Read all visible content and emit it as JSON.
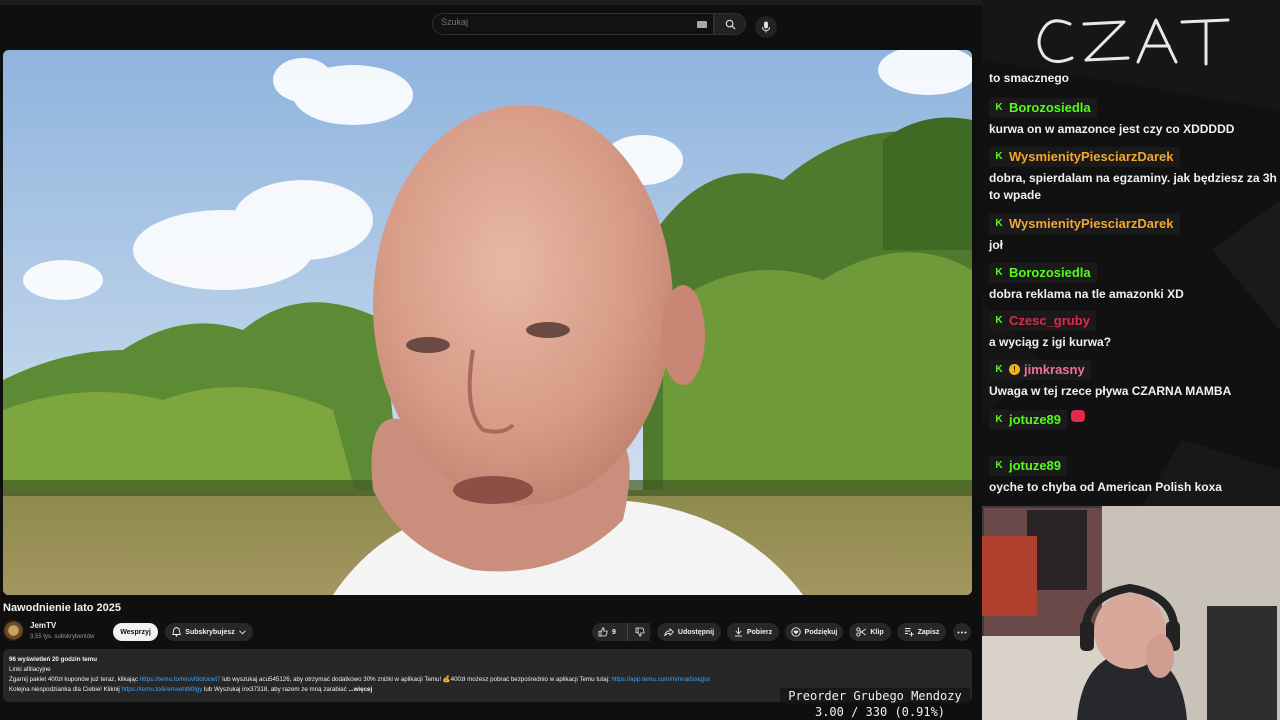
{
  "search": {
    "placeholder": "Szukaj"
  },
  "video": {
    "title": "Nawodnienie lato 2025",
    "channel": "JemTV",
    "subscribers": "3,55 tys. subskrybentów",
    "support_label": "Wesprzyj",
    "subscribe_label": "Subskrybujesz",
    "like_count": "9",
    "share_label": "Udostępnij",
    "download_label": "Pobierz",
    "thanks_label": "Podziękuj",
    "clip_label": "Klip",
    "save_label": "Zapisz"
  },
  "description": {
    "stats": "96 wyświetleń  20 godzin temu",
    "line1": "Linki afiliacyjne",
    "line2_a": "Zgarnij pakiet 400zł kuponów już teraz, klikając ",
    "line2_link1": "https://temu.to/m/uvfdotocwt7",
    "line2_b": " lub wyszukaj acu545126, aby otrzymać dodatkowo 30% zniżki w aplikacji Temu! 💰400zł możesz pobrać bezpośrednio w aplikacji Temu tutaj: ",
    "line2_link2": "https://app.temu.com/m/nnadsxiqjsx",
    "line3_a": "Kolejna niespodzianka dla Ciebie! Kliknij ",
    "line3_link": "https://temu.to/k/emveht80lgy",
    "line3_b": " lub Wyszukaj inx37318, aby razem ze mną zarabiać",
    "more": "...więcej"
  },
  "chat": {
    "first_message": "to smacznego",
    "messages": [
      {
        "user": "Borozosiedla",
        "color": "#53fc18",
        "text": "kurwa on w amazonce jest czy co XDDDDD"
      },
      {
        "user": "WysmienityPiesciarzDarek",
        "color": "#f2a72e",
        "text": "dobra, spierdalam na egzaminy. jak będziesz za 3h to wpade"
      },
      {
        "user": "WysmienityPiesciarzDarek",
        "color": "#f2a72e",
        "text": "joł"
      },
      {
        "user": "Borozosiedla",
        "color": "#53fc18",
        "text": "dobra reklama na tle amazonki XD"
      },
      {
        "user": "Czesc_gruby",
        "color": "#e0294d",
        "text": "a wyciąg z igi kurwa?"
      },
      {
        "user": "jimkrasny",
        "color": "#f06fa0",
        "text": "Uwaga w tej rzece pływa CZARNA MAMBA"
      },
      {
        "user": "jotuze89",
        "color": "#53fc18",
        "text": ""
      },
      {
        "user": "jotuze89",
        "color": "#53fc18",
        "text": "oyche to chyba od American Polish koxa"
      }
    ]
  },
  "overlay": {
    "goal_title": "Preorder Grubego Mendozy",
    "goal_progress": "3.00 / 330 (0.91%)",
    "czat_logo": "CZAT"
  },
  "colors": {
    "accent": "#53fc18",
    "link": "#3ea6ff",
    "background": "#0f0f0f"
  },
  "icons": [
    "keyboard-icon",
    "search-icon",
    "mic-icon",
    "bell-icon",
    "chevron-down-icon",
    "thumbs-up-icon",
    "thumbs-down-icon",
    "share-icon",
    "download-icon",
    "thanks-icon",
    "scissors-icon",
    "bookmark-icon",
    "more-icon",
    "kick-badge-icon",
    "gift-badge-icon",
    "heart-emote-icon"
  ]
}
